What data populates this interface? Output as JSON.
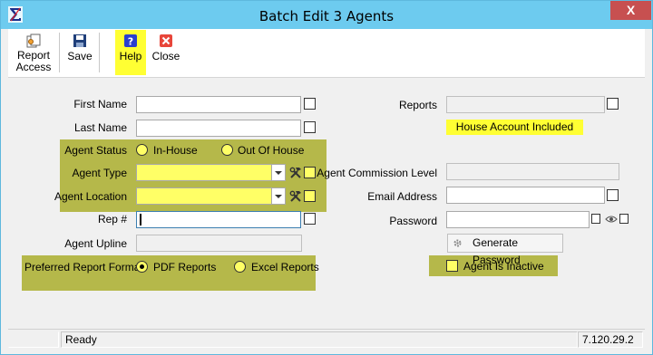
{
  "window": {
    "title": "Batch Edit 3 Agents",
    "close_glyph": "X",
    "app_icon": "sigma-icon"
  },
  "toolbar": {
    "report_access_line1": "Report",
    "report_access_line2": "Access",
    "save_label": "Save",
    "help_label": "Help",
    "close_label": "Close"
  },
  "form": {
    "first_name": {
      "label": "First Name",
      "value": ""
    },
    "last_name": {
      "label": "Last Name",
      "value": ""
    },
    "agent_status": {
      "label": "Agent Status",
      "options": [
        "In-House",
        "Out Of House"
      ],
      "selected": ""
    },
    "agent_type": {
      "label": "Agent Type",
      "value": ""
    },
    "agent_location": {
      "label": "Agent Location",
      "value": ""
    },
    "rep_num": {
      "label": "Rep #",
      "value": ""
    },
    "agent_upline": {
      "label": "Agent Upline",
      "value": ""
    },
    "preferred_report_format": {
      "label": "Preferred Report Format",
      "options": [
        "PDF Reports",
        "Excel Reports"
      ],
      "selected": "PDF Reports"
    },
    "reports": {
      "label": "Reports",
      "value": ""
    },
    "house_account": "House Account Included",
    "commission_level": {
      "label": "Agent Commission Level",
      "value": ""
    },
    "email": {
      "label": "Email Address",
      "value": ""
    },
    "password": {
      "label": "Password",
      "value": ""
    },
    "generate_password": "Generate Password",
    "agent_inactive": {
      "label": "Agent Is Inactive",
      "checked": false
    }
  },
  "status": {
    "text": "Ready",
    "version": "7.120.29.2"
  },
  "colors": {
    "titlebar": "#6dcbef",
    "highlight_group": "#b5b84a",
    "yellow_field": "#ffff66",
    "help_highlight": "#ffff33",
    "close_button": "#c75050"
  }
}
